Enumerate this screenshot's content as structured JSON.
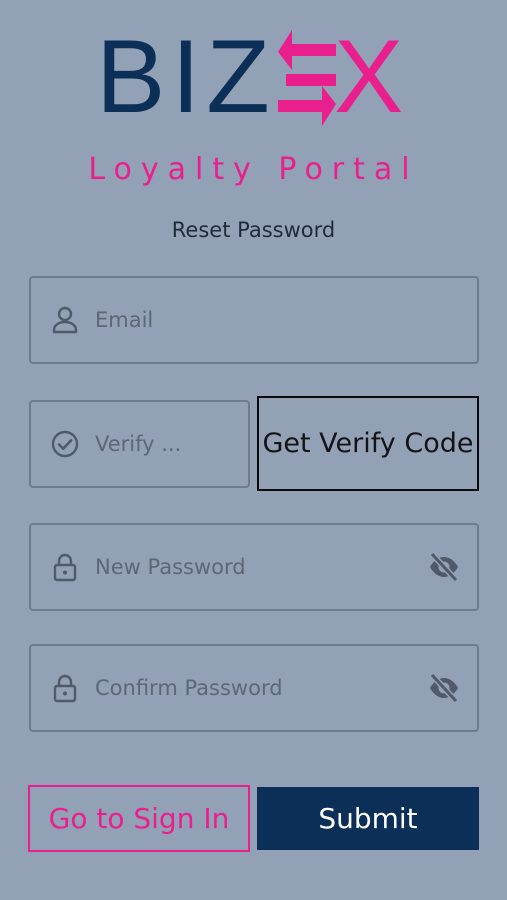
{
  "brand": {
    "logo_dark": "BIZ",
    "logo_x": "X",
    "subtitle": "Loyalty Portal",
    "color_dark": "#0c2f58",
    "color_pink": "#ea1f8e"
  },
  "page": {
    "heading": "Reset Password"
  },
  "form": {
    "email": {
      "placeholder": "Email",
      "icon": "person-icon"
    },
    "verify": {
      "placeholder": "Verify ...",
      "icon": "check-circle-icon"
    },
    "new_password": {
      "placeholder": "New Password",
      "icon": "lock-icon",
      "toggle_icon": "eye-off-icon"
    },
    "confirm_password": {
      "placeholder": "Confirm Password",
      "icon": "lock-icon",
      "toggle_icon": "eye-off-icon"
    }
  },
  "buttons": {
    "get_code": "Get Verify Code",
    "sign_in": "Go to Sign In",
    "submit": "Submit"
  }
}
